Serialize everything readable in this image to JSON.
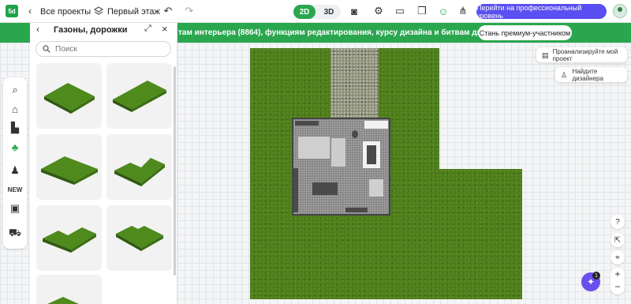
{
  "app": {
    "logo": "5d"
  },
  "topbar": {
    "projects_label": "Все проекты",
    "floor_label": "Первый этаж",
    "mode_2d": "2D",
    "mode_3d": "3D",
    "pro_button": "Перейти на профессиональный уровень"
  },
  "promo": {
    "text": "там интерьера (8864), функциям редактирования, курсу дизайна и битвам дизайнеров",
    "button": "Стань премиум-участником"
  },
  "panel": {
    "title": "Газоны, дорожки",
    "search_placeholder": "Поиск",
    "items": [
      "lawn-square",
      "lawn-rect",
      "lawn-wide",
      "lawn-l-shape",
      "lawn-l-shape-2",
      "lawn-notch",
      "lawn-partial"
    ]
  },
  "right": {
    "analyze": "Проанализируйте мой проект",
    "designer": "Найдите дизайнера",
    "ai_badge": "1"
  },
  "colors": {
    "accent": "#2aa64f",
    "pro": "#5a4ff0",
    "grass": "#4e7d1c"
  }
}
